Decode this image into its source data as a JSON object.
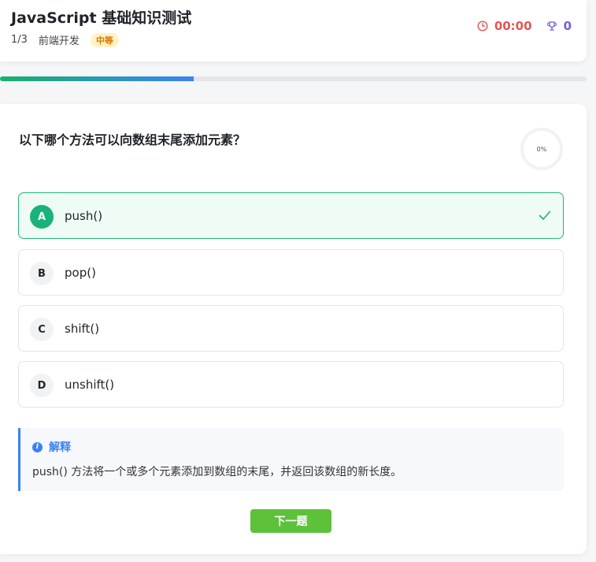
{
  "header": {
    "title": "JavaScript 基础知识测试",
    "question_index": "1/3",
    "category": "前端开发",
    "difficulty": "中等",
    "timer": "00:00",
    "score": "0"
  },
  "progress": {
    "fraction": 0.33
  },
  "question": {
    "text": "以下哪个方法可以向数组末尾添加元素？",
    "percent_label": "0%",
    "percent_value": 0
  },
  "options": [
    {
      "letter": "A",
      "text": "push()",
      "state": "correct"
    },
    {
      "letter": "B",
      "text": "pop()",
      "state": "default"
    },
    {
      "letter": "C",
      "text": "shift()",
      "state": "default"
    },
    {
      "letter": "D",
      "text": "unshift()",
      "state": "default"
    }
  ],
  "explanation": {
    "title": "解释",
    "text": "push() 方法将一个或多个元素添加到数组的末尾，并返回该数组的新长度。"
  },
  "actions": {
    "next_label": "下一题"
  },
  "colors": {
    "accent_green": "#19b37a",
    "accent_blue": "#3b82f6",
    "timer_red": "#e15656",
    "score_purple": "#7c5bd6",
    "button_green": "#5ec13a"
  },
  "icons": {
    "timer": "clock-icon",
    "score": "trophy-icon",
    "correct": "check-icon",
    "explain": "info-icon"
  }
}
